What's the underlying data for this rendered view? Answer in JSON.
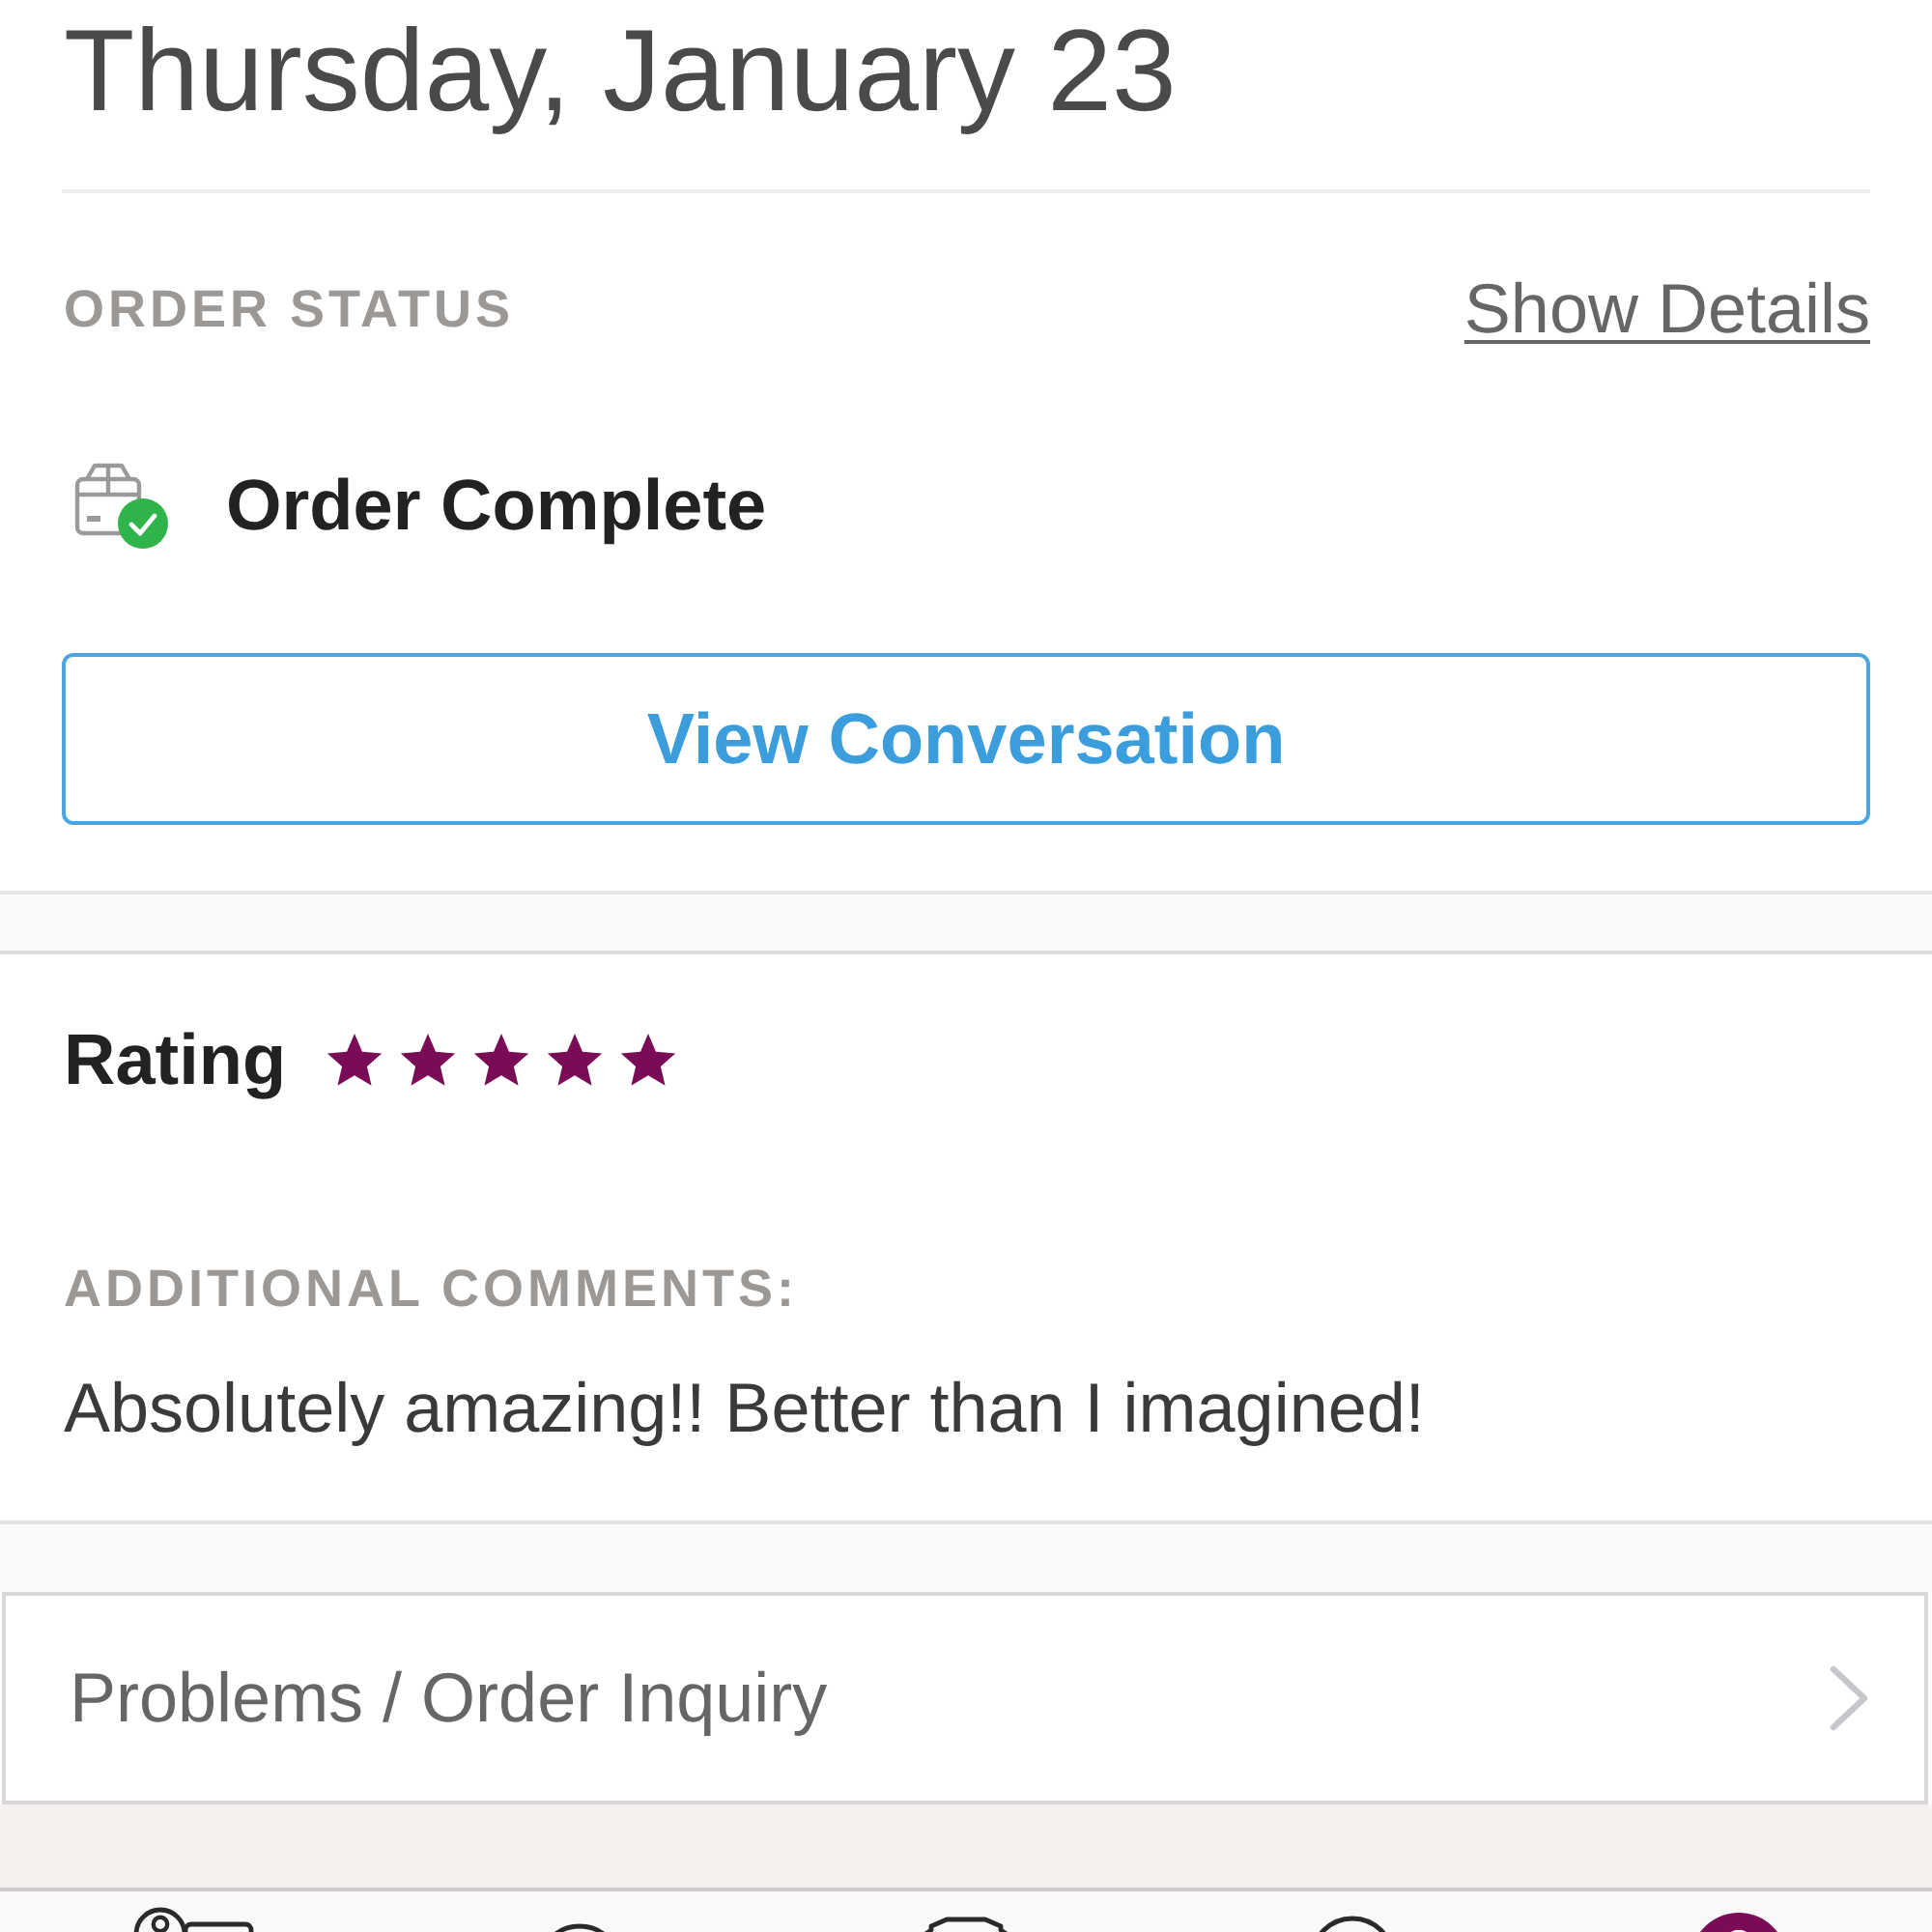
{
  "header": {
    "date": "Thursday, January 23"
  },
  "order_status": {
    "label": "ORDER STATUS",
    "link": "Show Details",
    "status": "Order Complete",
    "button": "View Conversation"
  },
  "rating": {
    "label": "Rating",
    "stars": 5
  },
  "comments": {
    "label": "ADDITIONAL COMMENTS:",
    "text": "Absolutely amazing!! Better than I imagined!"
  },
  "inquiry": {
    "label": "Problems / Order Inquiry"
  },
  "tab_bar": {
    "tabs": [
      {
        "selected": false
      },
      {
        "selected": false
      },
      {
        "selected": false
      },
      {
        "selected": false
      },
      {
        "selected": true
      }
    ]
  }
}
